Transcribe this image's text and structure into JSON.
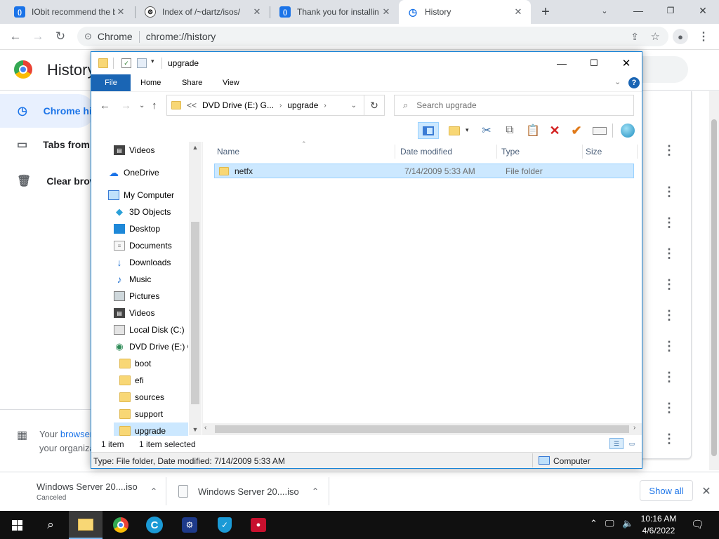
{
  "browser": {
    "tabs": [
      {
        "title": "IObit recommend the b",
        "icon": "iobit-favicon"
      },
      {
        "title": "Index of /~dartz/isos/",
        "icon": "folder-index-favicon"
      },
      {
        "title": "Thank you for installin",
        "icon": "iobit-favicon"
      },
      {
        "title": "History",
        "icon": "history-clock-icon"
      }
    ],
    "omnibox": {
      "site": "Chrome",
      "url": "chrome://history"
    }
  },
  "history_page": {
    "title": "History",
    "nav": [
      {
        "label": "Chrome history",
        "icon": "clock-icon"
      },
      {
        "label": "Tabs from other devices",
        "icon": "devices-icon"
      },
      {
        "label": "Clear browsing data",
        "icon": "trash-icon"
      }
    ],
    "managed": {
      "text_pre": "Your ",
      "link": "browser is managed by",
      "text_post": "your organization"
    }
  },
  "downloads": {
    "items": [
      {
        "name": "Windows Server 20....iso",
        "status": "Canceled"
      },
      {
        "name": "Windows Server 20....iso",
        "status": ""
      }
    ],
    "show_all": "Show all"
  },
  "explorer": {
    "title": "upgrade",
    "ribbon_tabs": [
      "File",
      "Home",
      "Share",
      "View"
    ],
    "breadcrumb": [
      "<<",
      "DVD Drive (E:) G...",
      "upgrade"
    ],
    "search_placeholder": "Search upgrade",
    "nav_items": [
      {
        "label": "Videos",
        "icon": "videos-icon",
        "level": 2
      },
      {
        "label": "OneDrive",
        "icon": "onedrive-icon",
        "level": 1
      },
      {
        "label": "My Computer",
        "icon": "computer-icon",
        "level": 1
      },
      {
        "label": "3D Objects",
        "icon": "3d-objects-icon",
        "level": 2
      },
      {
        "label": "Desktop",
        "icon": "desktop-icon",
        "level": 2
      },
      {
        "label": "Documents",
        "icon": "documents-icon",
        "level": 2
      },
      {
        "label": "Downloads",
        "icon": "downloads-icon",
        "level": 2
      },
      {
        "label": "Music",
        "icon": "music-icon",
        "level": 2
      },
      {
        "label": "Pictures",
        "icon": "pictures-icon",
        "level": 2
      },
      {
        "label": "Videos",
        "icon": "videos-icon",
        "level": 2
      },
      {
        "label": "Local Disk (C:)",
        "icon": "local-disk-icon",
        "level": 2
      },
      {
        "label": "DVD Drive (E:) GI",
        "icon": "dvd-drive-icon",
        "level": 2
      },
      {
        "label": "boot",
        "icon": "folder-icon",
        "level": 3
      },
      {
        "label": "efi",
        "icon": "folder-icon",
        "level": 3
      },
      {
        "label": "sources",
        "icon": "folder-icon",
        "level": 3
      },
      {
        "label": "support",
        "icon": "folder-icon",
        "level": 3
      },
      {
        "label": "upgrade",
        "icon": "folder-icon",
        "level": 3,
        "selected": true
      }
    ],
    "columns": [
      "Name",
      "Date modified",
      "Type",
      "Size"
    ],
    "files": [
      {
        "name": "netfx",
        "date": "7/14/2009 5:33 AM",
        "type": "File folder",
        "size": ""
      }
    ],
    "status": {
      "count": "1 item",
      "selected": "1 item selected"
    },
    "details_bar": "Type: File folder, Date modified: 7/14/2009 5:33 AM",
    "location": "Computer"
  },
  "taskbar": {
    "time": "10:16 AM",
    "date": "4/6/2022",
    "apps": [
      "file-explorer-icon",
      "chrome-icon",
      "ccleaner-icon",
      "app-icon",
      "shield-icon",
      "recorder-icon"
    ]
  },
  "colors": {
    "accent": "#1a73e8",
    "file_tab": "#1a65b4",
    "selection": "#cce8ff"
  }
}
